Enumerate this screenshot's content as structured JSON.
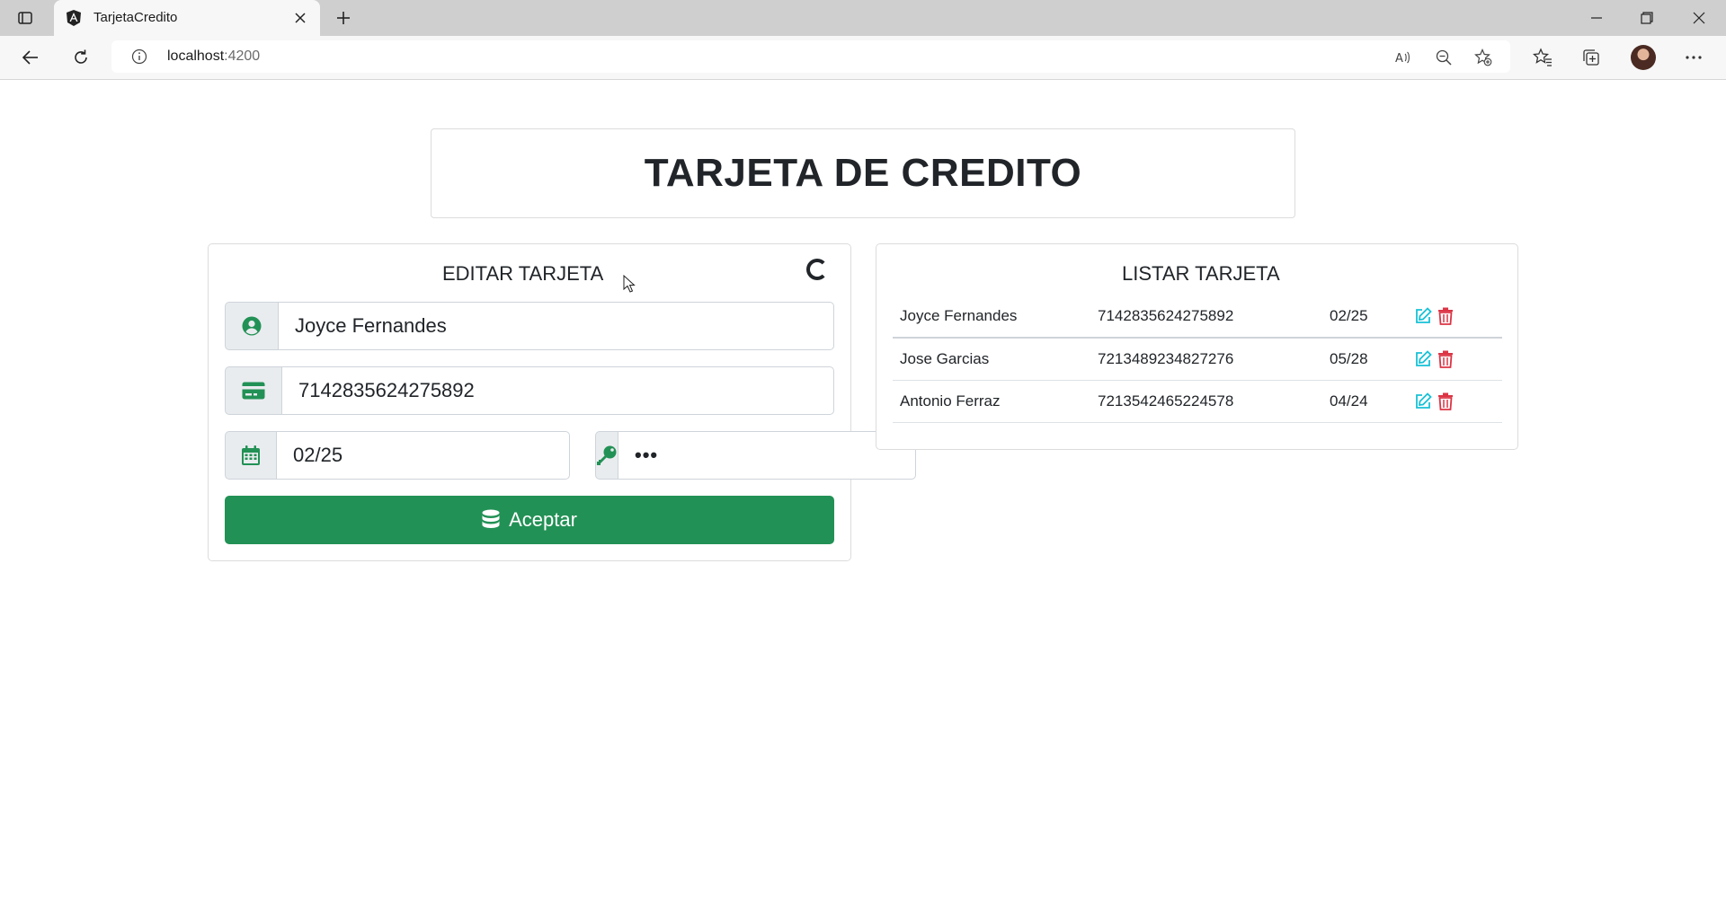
{
  "browser": {
    "tab_title": "TarjetaCredito",
    "url_host": "localhost",
    "url_port": ":4200"
  },
  "page": {
    "title": "TARJETA DE CREDITO"
  },
  "edit_form": {
    "title": "EDITAR TARJETA",
    "name_value": "Joyce Fernandes",
    "card_number_value": "7142835624275892",
    "expiry_value": "02/25",
    "cvv_value": "•••",
    "submit_label": "Aceptar"
  },
  "list": {
    "title": "LISTAR TARJETA",
    "rows": [
      {
        "name": "Joyce Fernandes",
        "number": "7142835624275892",
        "expiry": "02/25"
      },
      {
        "name": "Jose Garcias",
        "number": "7213489234827276",
        "expiry": "05/28"
      },
      {
        "name": "Antonio Ferraz",
        "number": "7213542465224578",
        "expiry": "04/24"
      }
    ]
  },
  "colors": {
    "accent_green": "#229155",
    "edit_icon": "#17c1d6",
    "delete_icon": "#dc3545"
  },
  "icons": [
    "tab-actions-icon",
    "angular-icon",
    "close-icon",
    "plus-icon",
    "minimize-icon",
    "restore-icon",
    "close-window-icon",
    "back-icon",
    "refresh-icon",
    "info-icon",
    "read-aloud-icon",
    "zoom-out-icon",
    "add-favorite-icon",
    "favorites-icon",
    "collections-icon",
    "more-icon",
    "user-circle-icon",
    "credit-card-icon",
    "calendar-icon",
    "key-icon",
    "database-icon",
    "edit-icon",
    "trash-icon",
    "spinner-icon"
  ]
}
